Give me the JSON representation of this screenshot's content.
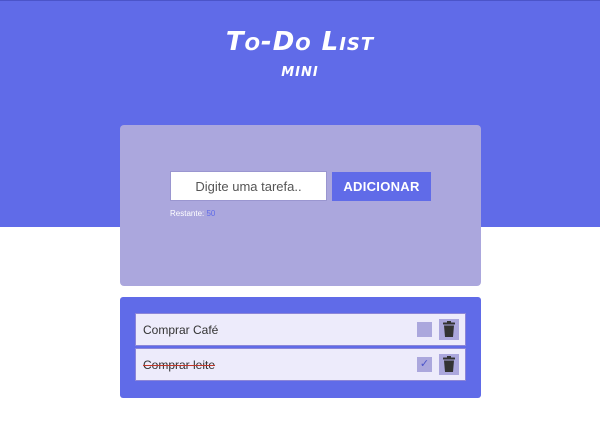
{
  "header": {
    "title": "To-Do List",
    "subtitle": "MINI"
  },
  "form": {
    "placeholder": "Digite uma tarefa..",
    "add_label": "ADICIONAR",
    "remaining_label": "Restante:",
    "remaining_count": "50"
  },
  "tasks": [
    {
      "text": "Comprar Café",
      "done": false,
      "check_mark": ""
    },
    {
      "text": "Comprar leite",
      "done": true,
      "check_mark": "✓"
    }
  ],
  "colors": {
    "primary": "#606be8",
    "card": "#aba7dd",
    "item_bg": "#edebfb",
    "icon_dark": "#333333"
  },
  "icons": {
    "check": "checkbox-icon",
    "delete": "trash-icon"
  }
}
